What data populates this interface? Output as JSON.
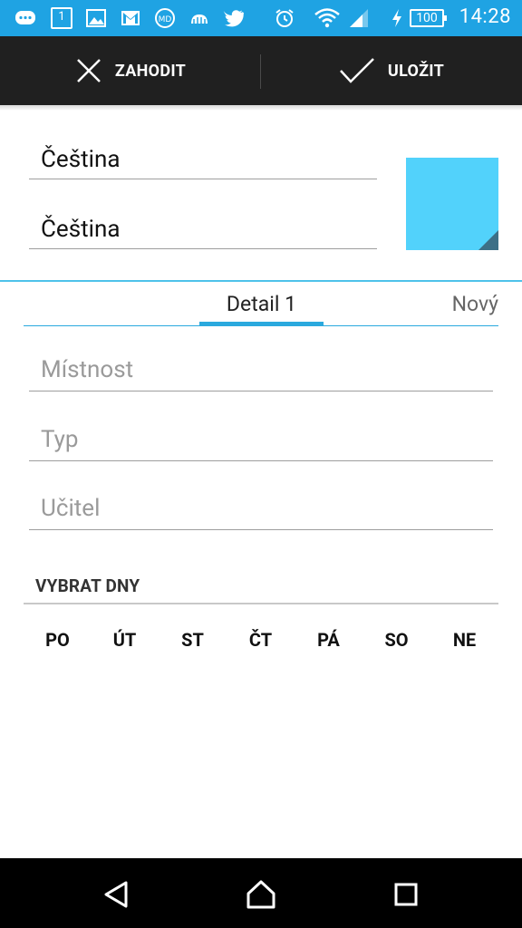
{
  "status_bar": {
    "time": "14:28",
    "battery": "100",
    "icons": [
      "messages-icon",
      "calendar-icon",
      "image-icon",
      "gmail-icon",
      "app-icon",
      "cloud-icon",
      "twitter-icon",
      "alarm-icon",
      "wifi-icon",
      "signal-icon",
      "charging-icon"
    ],
    "calendar_day": "1"
  },
  "action_bar": {
    "discard_label": "ZAHODIT",
    "save_label": "ULOŽIT"
  },
  "subject": {
    "name": "Čeština",
    "short_name": "Čeština",
    "color": "#52d2fb"
  },
  "tabs": [
    {
      "label": "Detail 1",
      "selected": true
    },
    {
      "label": "Nový",
      "selected": false
    }
  ],
  "fields": {
    "room_placeholder": "Místnost",
    "type_placeholder": "Typ",
    "teacher_placeholder": "Učitel"
  },
  "days": {
    "header": "VYBRAT DNY",
    "items": [
      "PO",
      "ÚT",
      "ST",
      "ČT",
      "PÁ",
      "SO",
      "NE"
    ]
  },
  "colors": {
    "status_bar": "#1fa3e3",
    "action_bar": "#202020",
    "accent": "#2aa9de"
  }
}
